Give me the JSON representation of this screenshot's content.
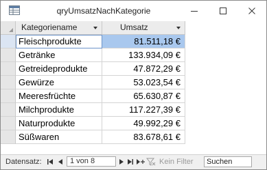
{
  "window": {
    "title": "qryUmsatzNachKategorie",
    "icon": "query-datasheet-icon",
    "buttons": [
      "minimize-icon",
      "maximize-icon",
      "close-icon"
    ]
  },
  "datasheet": {
    "columns": [
      {
        "label": "Kategoriename"
      },
      {
        "label": "Umsatz"
      }
    ],
    "rows": [
      {
        "name": "Fleischprodukte",
        "umsatz": "81.511,18 €"
      },
      {
        "name": "Getränke",
        "umsatz": "133.934,09 €"
      },
      {
        "name": "Getreideprodukte",
        "umsatz": "47.872,29 €"
      },
      {
        "name": "Gewürze",
        "umsatz": "53.023,54 €"
      },
      {
        "name": "Meeresfrüchte",
        "umsatz": "65.630,87 €"
      },
      {
        "name": "Milchprodukte",
        "umsatz": "117.227,39 €"
      },
      {
        "name": "Naturprodukte",
        "umsatz": "49.992,29 €"
      },
      {
        "name": "Süßwaren",
        "umsatz": "83.678,61 €"
      }
    ],
    "current_row": 1
  },
  "navigation": {
    "label": "Datensatz:",
    "position": "1 von 8",
    "filter_label": "Kein Filter",
    "search_value": "Suchen"
  },
  "colors": {
    "selected_cell": "#a9c8ee",
    "header_bg": "#ececec",
    "selector_bg": "#e6e6e6"
  }
}
